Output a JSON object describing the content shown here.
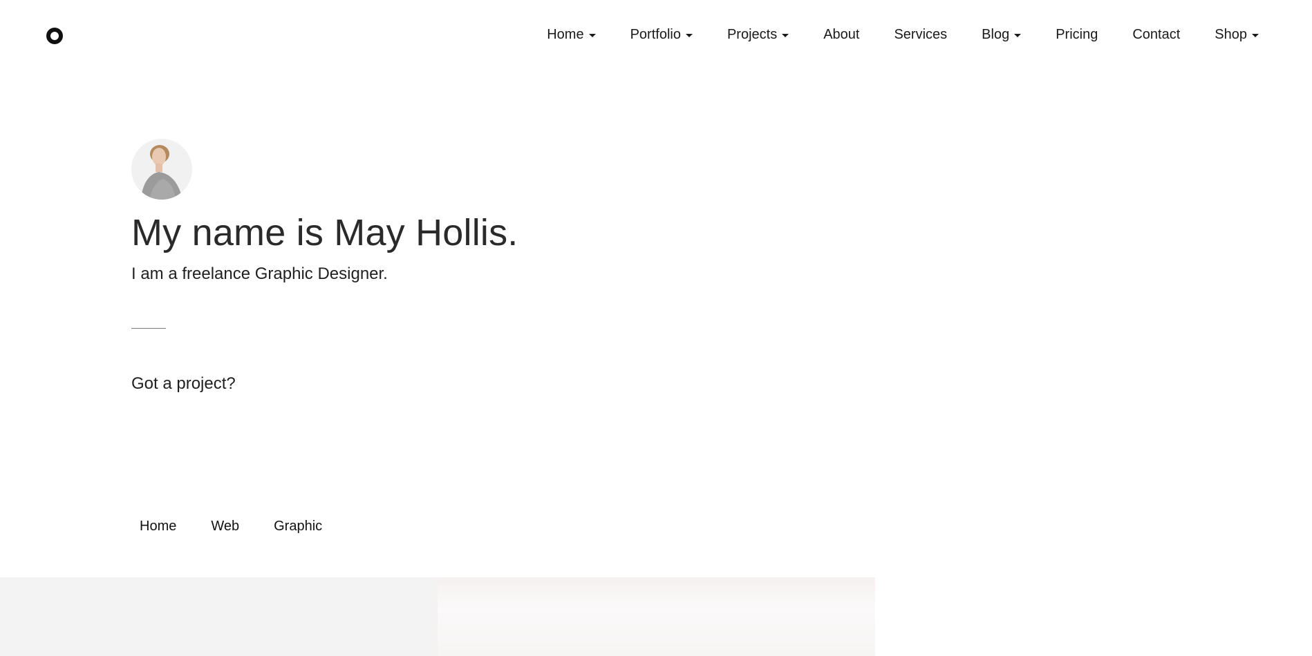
{
  "header": {
    "logo_icon": "ring-logo-icon",
    "nav": [
      {
        "label": "Home",
        "has_dropdown": true
      },
      {
        "label": "Portfolio",
        "has_dropdown": true
      },
      {
        "label": "Projects",
        "has_dropdown": true
      },
      {
        "label": "About",
        "has_dropdown": false
      },
      {
        "label": "Services",
        "has_dropdown": false
      },
      {
        "label": "Blog",
        "has_dropdown": true
      },
      {
        "label": "Pricing",
        "has_dropdown": false
      },
      {
        "label": "Contact",
        "has_dropdown": false
      },
      {
        "label": "Shop",
        "has_dropdown": true
      }
    ]
  },
  "hero": {
    "title": "My name is May Hollis.",
    "subtitle": "I am a freelance Graphic Designer.",
    "cta": "Got a project?"
  },
  "filters": [
    {
      "label": "Home"
    },
    {
      "label": "Web"
    },
    {
      "label": "Graphic"
    }
  ],
  "colors": {
    "text": "#222222",
    "background": "#ffffff",
    "tile_left": "#f4f3f3",
    "tile_right": "#f7f4f4"
  }
}
